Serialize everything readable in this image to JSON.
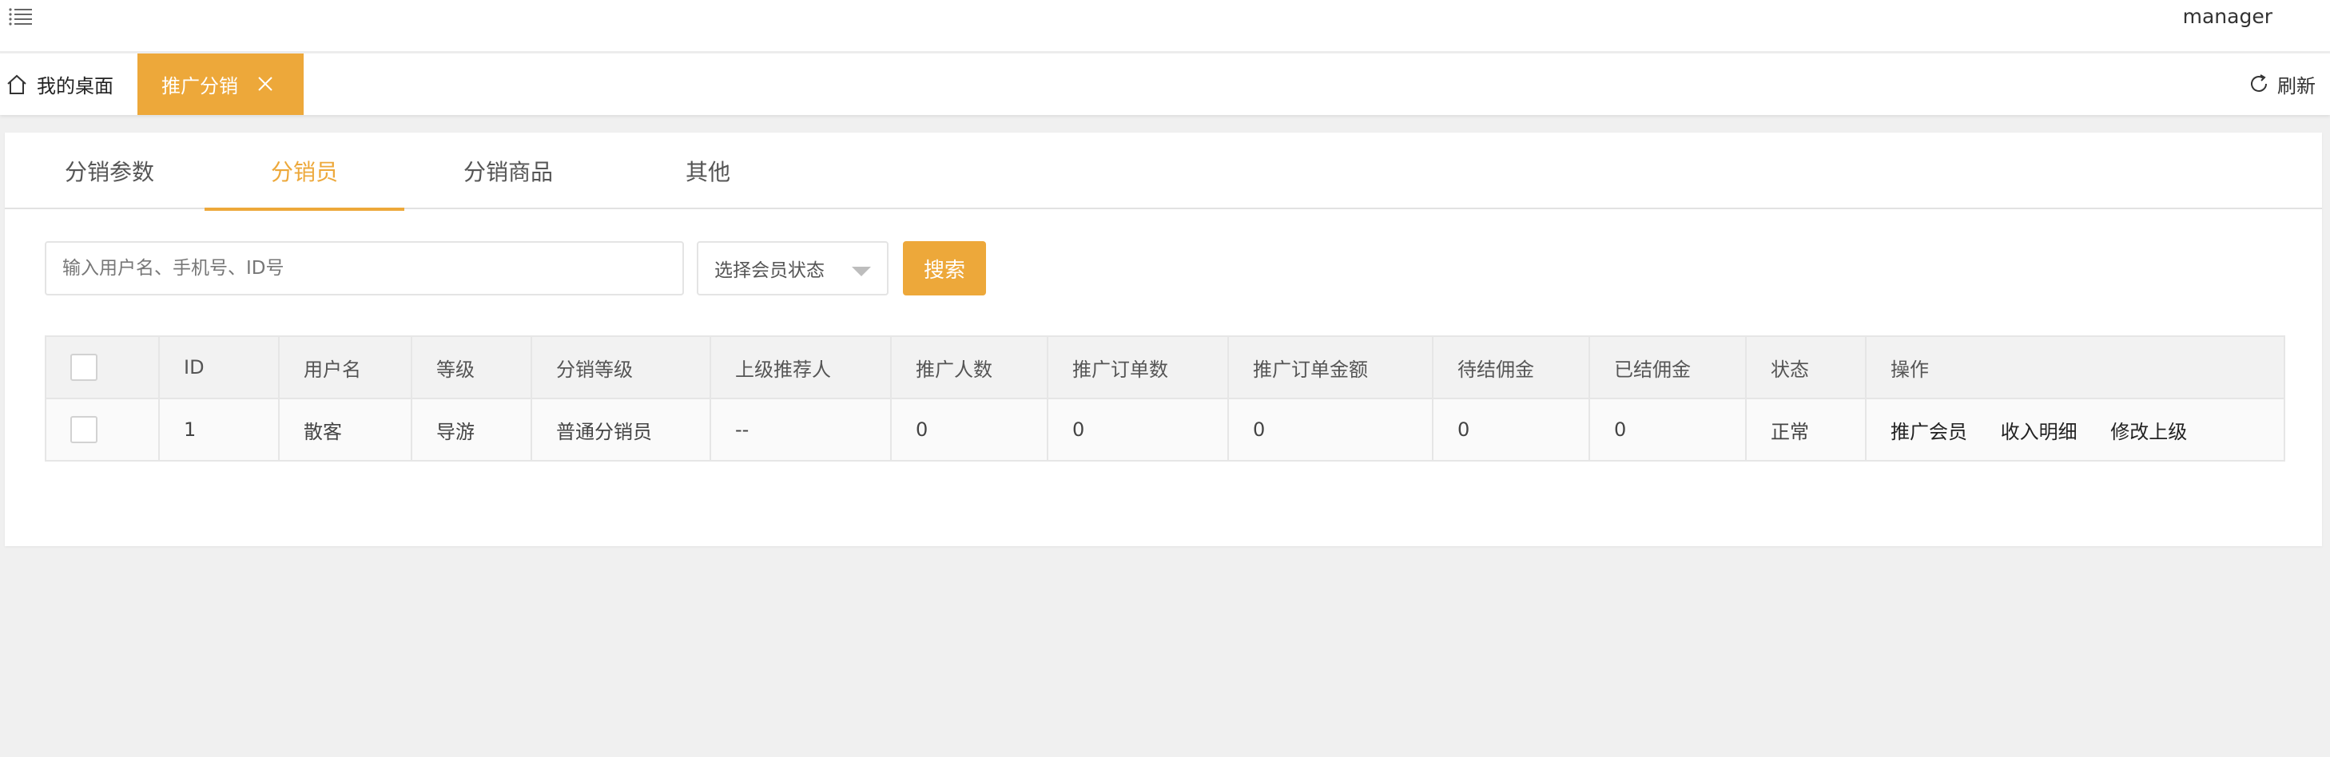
{
  "header": {
    "username": "manager"
  },
  "tabs": {
    "home_label": "我的桌面",
    "active_label": "推广分销",
    "refresh_label": "刷新"
  },
  "subtabs": [
    {
      "label": "分销参数",
      "active": false
    },
    {
      "label": "分销员",
      "active": true
    },
    {
      "label": "分销商品",
      "active": false
    },
    {
      "label": "其他",
      "active": false
    }
  ],
  "search": {
    "placeholder": "输入用户名、手机号、ID号",
    "status_select": "选择会员状态",
    "button_label": "搜索"
  },
  "table": {
    "columns": [
      "ID",
      "用户名",
      "等级",
      "分销等级",
      "上级推荐人",
      "推广人数",
      "推广订单数",
      "推广订单金额",
      "待结佣金",
      "已结佣金",
      "状态",
      "操作"
    ],
    "rows": [
      {
        "id": "1",
        "username": "散客",
        "level": "导游",
        "dist_level": "普通分销员",
        "referrer": "--",
        "promo_count": "0",
        "promo_orders": "0",
        "promo_amount": "0",
        "pending_commission": "0",
        "settled_commission": "0",
        "status": "正常",
        "actions": [
          "推广会员",
          "收入明细",
          "修改上级"
        ]
      }
    ]
  },
  "colors": {
    "accent": "#eda83a",
    "background": "#f0f0f0"
  }
}
